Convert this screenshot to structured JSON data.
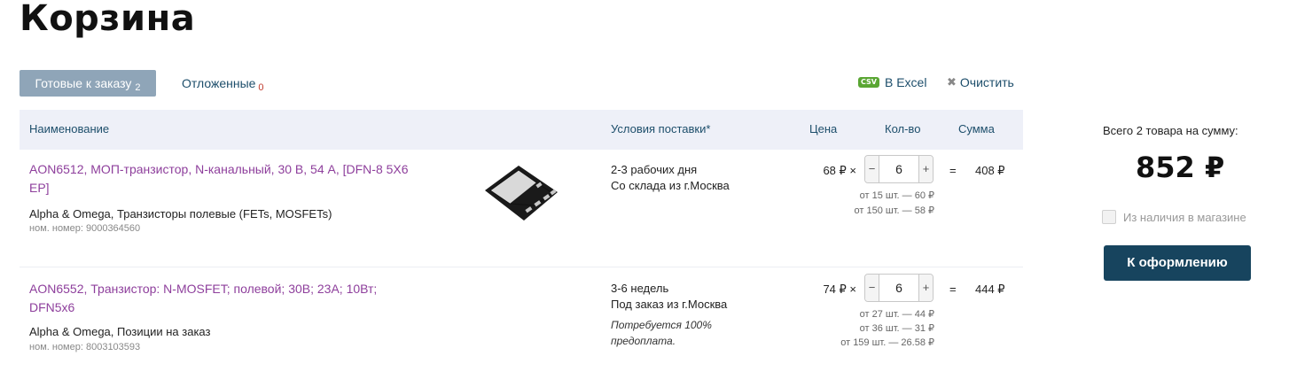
{
  "page_title": "Корзина",
  "tabs": {
    "ready": {
      "label": "Готовые к заказу",
      "count": "2"
    },
    "deferred": {
      "label": "Отложенные",
      "count": "0"
    }
  },
  "actions": {
    "csv_badge": "CSV",
    "excel": "В Excel",
    "clear": "Очистить"
  },
  "table": {
    "headers": {
      "name": "Наименование",
      "delivery": "Условия поставки*",
      "price": "Цена",
      "qty": "Кол-во",
      "sum": "Сумма"
    },
    "rows": [
      {
        "title_line1": "AON6512, МОП-транзистор, N-канальный, 30 В, 54 А, [DFN-8 5X6",
        "title_line2": "EP]",
        "meta": "Alpha & Omega, Транзисторы полевые (FETs, MOSFETs)",
        "number": "ном. номер: 9000364560",
        "delivery_line1": "2-3 рабочих дня",
        "delivery_line2": "Со склада из г.Москва",
        "note_line1": "",
        "note_line2": "",
        "price": "68 ₽ ×",
        "qty": "6",
        "eq": "=",
        "sum": "408 ₽",
        "tiers": [
          "от 15 шт. — 60 ₽",
          "от 150 шт. — 58 ₽"
        ]
      },
      {
        "title_line1": "AON6552, Транзистор: N-MOSFET; полевой; 30В; 23А; 10Вт;",
        "title_line2": "DFN5x6",
        "meta": "Alpha & Omega, Позиции на заказ",
        "number": "ном. номер: 8003103593",
        "delivery_line1": "3-6 недель",
        "delivery_line2": "Под заказ из г.Москва",
        "note_line1": "Потребуется 100%",
        "note_line2": "предоплата.",
        "price": "74 ₽ ×",
        "qty": "6",
        "eq": "=",
        "sum": "444 ₽",
        "tiers": [
          "от 27 шт. — 44 ₽",
          "от 36 шт. — 31 ₽",
          "от 159 шт. — 26.58 ₽"
        ]
      }
    ],
    "qty_minus": "−",
    "qty_plus": "+"
  },
  "summary": {
    "label": "Всего 2 товара на сумму:",
    "total": "852 ₽",
    "stock_label": "Из наличия в магазине",
    "checkout": "К оформлению"
  },
  "colors": {
    "tab_active": "#8fa5b8",
    "link": "#1d4e6b",
    "product_link": "#8e3f9c",
    "checkout_bg": "#17445e",
    "header_bg": "#eef0f8"
  }
}
